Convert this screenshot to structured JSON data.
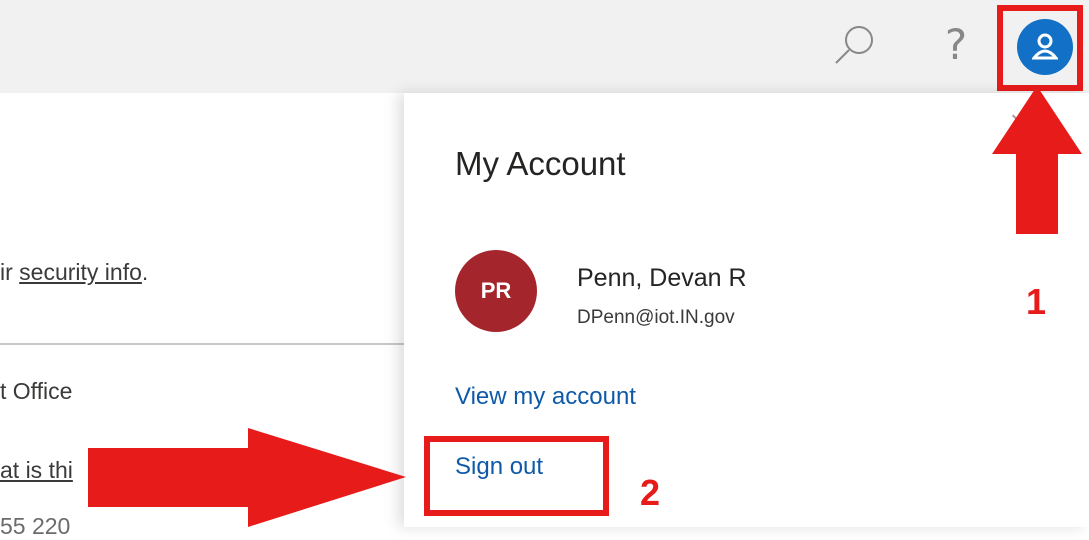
{
  "header": {
    "search_icon": "search-icon",
    "help_label": "?",
    "account_icon": "person-icon",
    "account_color": "#1370c7"
  },
  "left_pane": {
    "security_prefix": "ir ",
    "security_link": "security info",
    "security_suffix": ".",
    "office_text": "t Office",
    "what_link": "at is thi",
    "bottom_text": "55 220"
  },
  "account_panel": {
    "title": "My Account",
    "initials": "PR",
    "name": "Penn, Devan R",
    "email": "DPenn@iot.IN.gov",
    "view_account": "View my account",
    "sign_out": "Sign out",
    "close_label": "×"
  },
  "annotations": {
    "step1": "1",
    "step2": "2",
    "highlight_color": "#e81b1b"
  }
}
